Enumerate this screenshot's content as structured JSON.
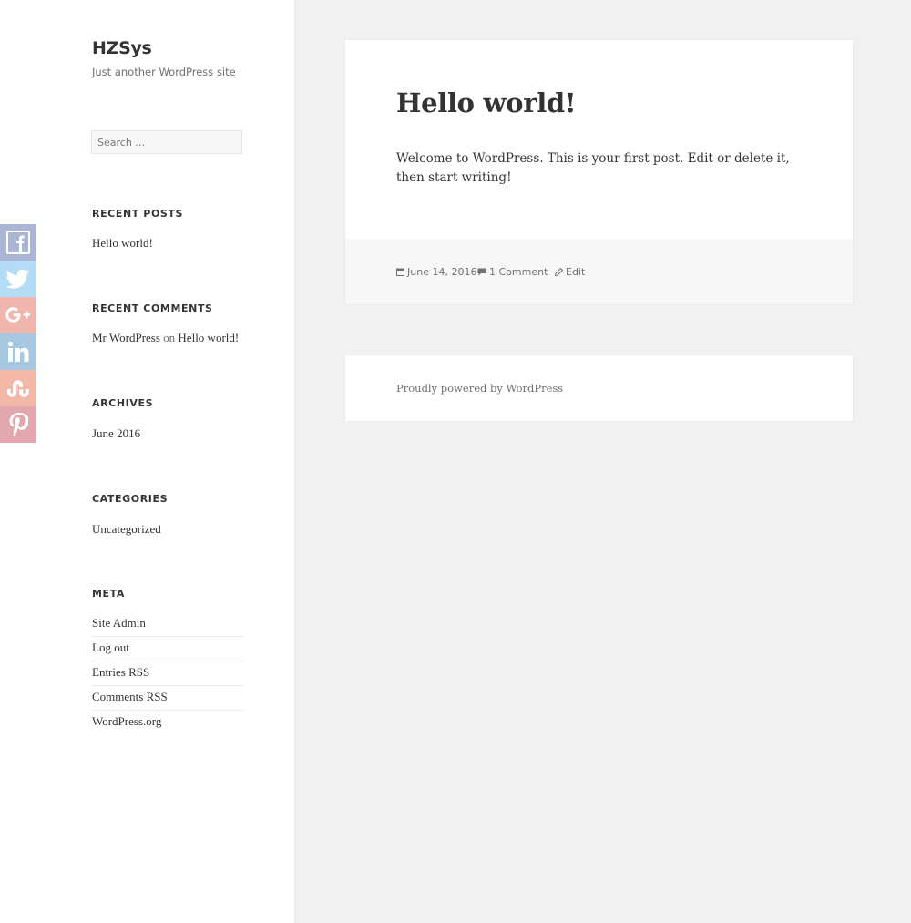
{
  "site": {
    "title": "HZSys",
    "description": "Just another WordPress site"
  },
  "search": {
    "placeholder": "Search …"
  },
  "widgets": {
    "recent_posts": {
      "title": "RECENT POSTS",
      "items": [
        "Hello world!"
      ]
    },
    "recent_comments": {
      "title": "RECENT COMMENTS",
      "author": "Mr WordPress",
      "connector": "on",
      "post": "Hello world!"
    },
    "archives": {
      "title": "ARCHIVES",
      "items": [
        "June 2016"
      ]
    },
    "categories": {
      "title": "CATEGORIES",
      "items": [
        "Uncategorized"
      ]
    },
    "meta": {
      "title": "META",
      "items": [
        "Site Admin",
        "Log out",
        "Entries RSS",
        "Comments RSS",
        "WordPress.org"
      ]
    }
  },
  "share_buttons": [
    {
      "icon": "facebook-icon",
      "color": "#aab4d4"
    },
    {
      "icon": "twitter-icon",
      "color": "#b3dcf6"
    },
    {
      "icon": "google-plus-icon",
      "color": "#f0b5ac"
    },
    {
      "icon": "linkedin-icon",
      "color": "#a5c8e0"
    },
    {
      "icon": "stumbleupon-icon",
      "color": "#f3b7a6"
    },
    {
      "icon": "pinterest-icon",
      "color": "#e2a6ae"
    }
  ],
  "post": {
    "title": "Hello world!",
    "body": "Welcome to WordPress. This is your first post. Edit or delete it, then start writing!",
    "date": "June 14, 2016",
    "comments": "1 Comment",
    "edit": "Edit"
  },
  "footer": {
    "credit": "Proudly powered by WordPress"
  },
  "colors": {
    "background": "#f1f1f1",
    "card": "#ffffff",
    "text": "#333333",
    "muted": "#707070"
  }
}
